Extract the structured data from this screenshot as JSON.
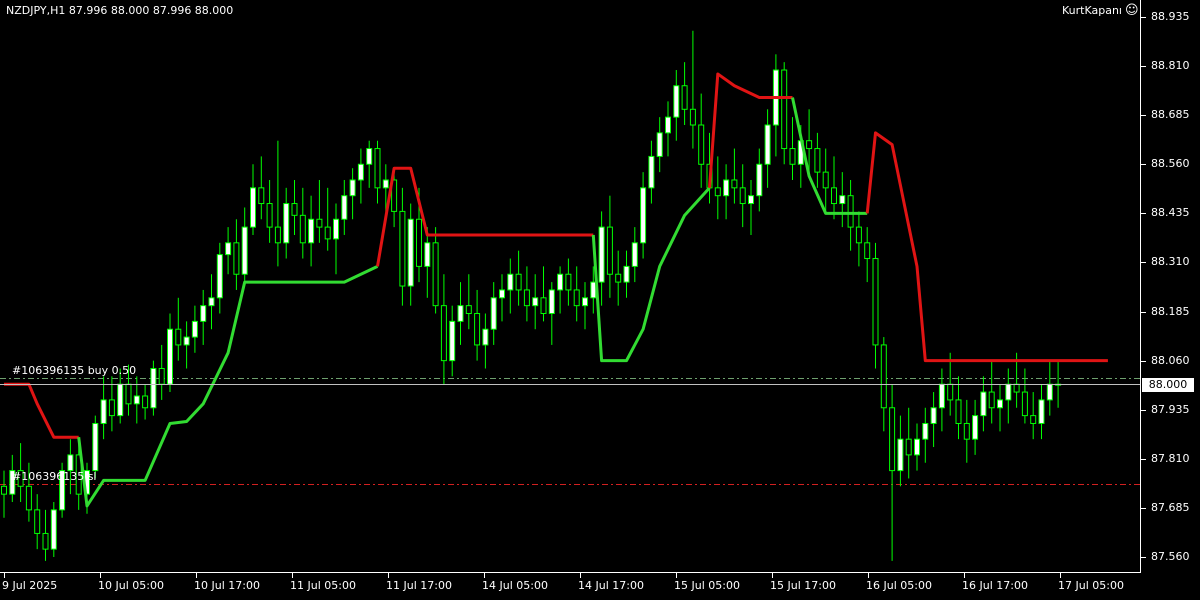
{
  "header": {
    "symbol_info": "NZDJPY,H1  87.996 88.000 87.996 88.000",
    "brand": "KurtKapanı",
    "brand_icon": "smiley-icon"
  },
  "price_axis": {
    "ticks": [
      "88.935",
      "88.810",
      "88.685",
      "88.560",
      "88.435",
      "88.310",
      "88.185",
      "88.060",
      "87.935",
      "87.810",
      "87.685",
      "87.560"
    ],
    "current_price": "88.000"
  },
  "time_axis": {
    "labels": [
      "9 Jul 2025",
      "10 Jul 05:00",
      "10 Jul 17:00",
      "11 Jul 05:00",
      "11 Jul 17:00",
      "14 Jul 05:00",
      "14 Jul 17:00",
      "15 Jul 05:00",
      "15 Jul 17:00",
      "16 Jul 05:00",
      "16 Jul 17:00",
      "17 Jul 05:00"
    ]
  },
  "orders": [
    {
      "label": "#106396135 buy 0.50",
      "price": 88.015,
      "color": "#6ea06e"
    },
    {
      "label": "#106396135 sl",
      "price": 87.745,
      "color": "#d22020"
    }
  ],
  "colors": {
    "background": "#000000",
    "bull_candle": "#ffffff",
    "bear_candle": "#000000",
    "wick": "#00ff00",
    "trail_up": "#32dc32",
    "trail_down": "#e01414"
  },
  "chart_data": {
    "type": "candlestick",
    "symbol": "NZDJPY",
    "timeframe": "H1",
    "ylim": [
      87.52,
      88.95
    ],
    "indicator": {
      "name": "",
      "segments": [
        {
          "trend": "down",
          "points": [
            [
              0,
              88.0
            ],
            [
              3,
              88.0
            ],
            [
              4,
              87.95
            ],
            [
              6,
              87.865
            ],
            [
              9,
              87.865
            ]
          ]
        },
        {
          "trend": "up",
          "points": [
            [
              9,
              87.865
            ],
            [
              10,
              87.69
            ],
            [
              12,
              87.755
            ],
            [
              17,
              87.755
            ],
            [
              20,
              87.9
            ],
            [
              22,
              87.905
            ],
            [
              24,
              87.95
            ],
            [
              27,
              88.08
            ],
            [
              29,
              88.26
            ],
            [
              41,
              88.26
            ],
            [
              45,
              88.3
            ]
          ]
        },
        {
          "trend": "down",
          "points": [
            [
              45,
              88.3
            ],
            [
              47,
              88.55
            ],
            [
              49,
              88.55
            ],
            [
              51,
              88.38
            ],
            [
              71,
              88.38
            ]
          ]
        },
        {
          "trend": "up",
          "points": [
            [
              71,
              88.38
            ],
            [
              72,
              88.06
            ],
            [
              75,
              88.06
            ],
            [
              77,
              88.14
            ],
            [
              79,
              88.3
            ],
            [
              82,
              88.43
            ],
            [
              85,
              88.5
            ]
          ]
        },
        {
          "trend": "down",
          "points": [
            [
              85,
              88.5
            ],
            [
              86,
              88.79
            ],
            [
              88,
              88.76
            ],
            [
              91,
              88.73
            ],
            [
              95,
              88.73
            ]
          ]
        },
        {
          "trend": "up",
          "points": [
            [
              95,
              88.73
            ],
            [
              97,
              88.53
            ],
            [
              99,
              88.435
            ],
            [
              104,
              88.435
            ]
          ]
        },
        {
          "trend": "down",
          "points": [
            [
              104,
              88.435
            ],
            [
              105,
              88.64
            ],
            [
              107,
              88.61
            ],
            [
              110,
              88.3
            ],
            [
              111,
              88.06
            ],
            [
              133,
              88.06
            ]
          ]
        }
      ]
    },
    "candles": [
      [
        87.74,
        87.78,
        87.66,
        87.72
      ],
      [
        87.72,
        87.82,
        87.7,
        87.78
      ],
      [
        87.78,
        87.85,
        87.7,
        87.74
      ],
      [
        87.74,
        87.8,
        87.65,
        87.68
      ],
      [
        87.68,
        87.72,
        87.58,
        87.62
      ],
      [
        87.62,
        87.68,
        87.55,
        87.58
      ],
      [
        87.58,
        87.7,
        87.56,
        87.68
      ],
      [
        87.68,
        87.8,
        87.66,
        87.78
      ],
      [
        87.78,
        87.86,
        87.72,
        87.82
      ],
      [
        87.82,
        87.86,
        87.68,
        87.72
      ],
      [
        87.72,
        87.8,
        87.67,
        87.78
      ],
      [
        87.78,
        87.92,
        87.76,
        87.9
      ],
      [
        87.9,
        88.02,
        87.86,
        87.96
      ],
      [
        87.96,
        88.02,
        87.88,
        87.92
      ],
      [
        87.92,
        88.04,
        87.9,
        88.0
      ],
      [
        88.0,
        88.05,
        87.92,
        87.95
      ],
      [
        87.95,
        88.02,
        87.9,
        87.97
      ],
      [
        87.97,
        88.0,
        87.91,
        87.94
      ],
      [
        87.94,
        88.06,
        87.92,
        88.04
      ],
      [
        88.04,
        88.1,
        87.96,
        88.0
      ],
      [
        88.0,
        88.18,
        87.98,
        88.14
      ],
      [
        88.14,
        88.22,
        88.06,
        88.1
      ],
      [
        88.1,
        88.16,
        88.04,
        88.12
      ],
      [
        88.12,
        88.2,
        88.08,
        88.16
      ],
      [
        88.16,
        88.24,
        88.1,
        88.2
      ],
      [
        88.2,
        88.28,
        88.14,
        88.22
      ],
      [
        88.22,
        88.36,
        88.18,
        88.33
      ],
      [
        88.33,
        88.4,
        88.28,
        88.36
      ],
      [
        88.36,
        88.42,
        88.24,
        88.28
      ],
      [
        88.28,
        88.45,
        88.26,
        88.4
      ],
      [
        88.4,
        88.56,
        88.38,
        88.5
      ],
      [
        88.5,
        88.58,
        88.42,
        88.46
      ],
      [
        88.46,
        88.52,
        88.36,
        88.4
      ],
      [
        88.4,
        88.62,
        88.3,
        88.36
      ],
      [
        88.36,
        88.5,
        88.32,
        88.46
      ],
      [
        88.46,
        88.52,
        88.38,
        88.43
      ],
      [
        88.43,
        88.5,
        88.32,
        88.36
      ],
      [
        88.36,
        88.48,
        88.3,
        88.42
      ],
      [
        88.42,
        88.52,
        88.36,
        88.4
      ],
      [
        88.4,
        88.5,
        88.34,
        88.37
      ],
      [
        88.37,
        88.46,
        88.28,
        88.42
      ],
      [
        88.42,
        88.52,
        88.38,
        88.48
      ],
      [
        88.48,
        88.55,
        88.42,
        88.52
      ],
      [
        88.52,
        88.6,
        88.46,
        88.56
      ],
      [
        88.56,
        88.62,
        88.5,
        88.6
      ],
      [
        88.6,
        88.62,
        88.46,
        88.5
      ],
      [
        88.5,
        88.56,
        88.44,
        88.52
      ],
      [
        88.52,
        88.55,
        88.4,
        88.44
      ],
      [
        88.44,
        88.5,
        88.2,
        88.25
      ],
      [
        88.25,
        88.46,
        88.2,
        88.42
      ],
      [
        88.42,
        88.5,
        88.26,
        88.3
      ],
      [
        88.3,
        88.4,
        88.22,
        88.36
      ],
      [
        88.36,
        88.4,
        88.18,
        88.2
      ],
      [
        88.2,
        88.28,
        88.0,
        88.06
      ],
      [
        88.06,
        88.2,
        88.02,
        88.16
      ],
      [
        88.16,
        88.26,
        88.1,
        88.2
      ],
      [
        88.2,
        88.28,
        88.14,
        88.18
      ],
      [
        88.18,
        88.24,
        88.06,
        88.1
      ],
      [
        88.1,
        88.18,
        88.04,
        88.14
      ],
      [
        88.14,
        88.26,
        88.1,
        88.22
      ],
      [
        88.22,
        88.28,
        88.16,
        88.24
      ],
      [
        88.24,
        88.32,
        88.18,
        88.28
      ],
      [
        88.28,
        88.34,
        88.2,
        88.24
      ],
      [
        88.24,
        88.3,
        88.16,
        88.2
      ],
      [
        88.2,
        88.28,
        88.14,
        88.22
      ],
      [
        88.22,
        88.3,
        88.16,
        88.18
      ],
      [
        88.18,
        88.26,
        88.1,
        88.24
      ],
      [
        88.24,
        88.3,
        88.18,
        88.28
      ],
      [
        88.28,
        88.32,
        88.2,
        88.24
      ],
      [
        88.24,
        88.3,
        88.16,
        88.2
      ],
      [
        88.2,
        88.26,
        88.14,
        88.22
      ],
      [
        88.22,
        88.3,
        88.18,
        88.26
      ],
      [
        88.26,
        88.44,
        88.2,
        88.4
      ],
      [
        88.4,
        88.48,
        88.22,
        88.28
      ],
      [
        88.28,
        88.34,
        88.2,
        88.26
      ],
      [
        88.26,
        88.34,
        88.22,
        88.3
      ],
      [
        88.3,
        88.4,
        88.26,
        88.36
      ],
      [
        88.36,
        88.54,
        88.32,
        88.5
      ],
      [
        88.5,
        88.62,
        88.46,
        88.58
      ],
      [
        88.58,
        88.68,
        88.54,
        88.64
      ],
      [
        88.64,
        88.72,
        88.58,
        88.68
      ],
      [
        88.68,
        88.8,
        88.62,
        88.76
      ],
      [
        88.76,
        88.82,
        88.66,
        88.7
      ],
      [
        88.7,
        88.9,
        88.6,
        88.66
      ],
      [
        88.66,
        88.74,
        88.5,
        88.56
      ],
      [
        88.56,
        88.64,
        88.46,
        88.5
      ],
      [
        88.5,
        88.58,
        88.42,
        88.48
      ],
      [
        88.48,
        88.56,
        88.42,
        88.52
      ],
      [
        88.52,
        88.6,
        88.46,
        88.5
      ],
      [
        88.5,
        88.56,
        88.4,
        88.46
      ],
      [
        88.46,
        88.52,
        88.38,
        88.48
      ],
      [
        88.48,
        88.6,
        88.44,
        88.56
      ],
      [
        88.56,
        88.7,
        88.5,
        88.66
      ],
      [
        88.66,
        88.84,
        88.58,
        88.8
      ],
      [
        88.8,
        88.82,
        88.56,
        88.6
      ],
      [
        88.6,
        88.68,
        88.52,
        88.56
      ],
      [
        88.56,
        88.66,
        88.5,
        88.62
      ],
      [
        88.62,
        88.7,
        88.54,
        88.6
      ],
      [
        88.6,
        88.64,
        88.5,
        88.54
      ],
      [
        88.54,
        88.6,
        88.44,
        88.5
      ],
      [
        88.5,
        88.58,
        88.42,
        88.46
      ],
      [
        88.46,
        88.54,
        88.4,
        88.48
      ],
      [
        88.48,
        88.52,
        88.34,
        88.4
      ],
      [
        88.4,
        88.44,
        88.3,
        88.36
      ],
      [
        88.36,
        88.4,
        88.26,
        88.32
      ],
      [
        88.32,
        88.36,
        88.04,
        88.1
      ],
      [
        88.1,
        88.12,
        87.88,
        87.94
      ],
      [
        87.94,
        88.0,
        87.55,
        87.78
      ],
      [
        87.78,
        87.92,
        87.74,
        87.86
      ],
      [
        87.86,
        87.94,
        87.76,
        87.82
      ],
      [
        87.82,
        87.9,
        87.78,
        87.86
      ],
      [
        87.86,
        87.94,
        87.8,
        87.9
      ],
      [
        87.9,
        87.98,
        87.84,
        87.94
      ],
      [
        87.94,
        88.04,
        87.88,
        88.0
      ],
      [
        88.0,
        88.08,
        87.92,
        87.96
      ],
      [
        87.96,
        88.02,
        87.86,
        87.9
      ],
      [
        87.9,
        87.96,
        87.8,
        87.86
      ],
      [
        87.86,
        87.96,
        87.82,
        87.92
      ],
      [
        87.92,
        88.02,
        87.88,
        87.98
      ],
      [
        87.98,
        88.06,
        87.9,
        87.94
      ],
      [
        87.94,
        88.0,
        87.88,
        87.96
      ],
      [
        87.96,
        88.04,
        87.9,
        88.0
      ],
      [
        88.0,
        88.08,
        87.94,
        87.98
      ],
      [
        87.98,
        88.04,
        87.9,
        87.92
      ],
      [
        87.92,
        87.98,
        87.86,
        87.9
      ],
      [
        87.9,
        88.0,
        87.86,
        87.96
      ],
      [
        87.96,
        88.06,
        87.92,
        88.0
      ],
      [
        88.0,
        88.06,
        87.94,
        88.0
      ]
    ]
  }
}
